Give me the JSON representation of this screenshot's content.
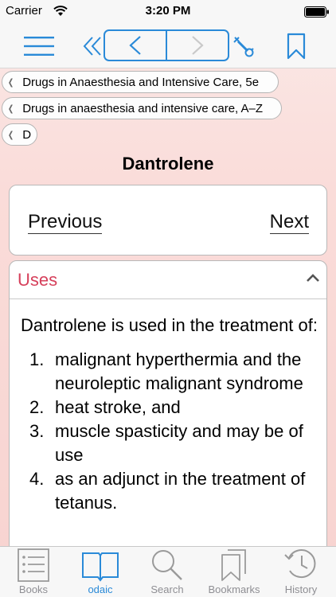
{
  "status_bar": {
    "carrier": "Carrier",
    "time": "3:20 PM"
  },
  "toolbar": {
    "menu_icon": "hamburger-menu-icon",
    "rewind_icon": "double-chevron-left-icon",
    "back_icon": "chevron-left-icon",
    "forward_icon": "chevron-right-icon",
    "wrench_icon": "wrench-icon",
    "bookmark_icon": "bookmark-icon"
  },
  "breadcrumbs": [
    {
      "label": "Drugs in Anaesthesia and Intensive Care, 5e"
    },
    {
      "label": "Drugs in anaesthesia and intensive care, A–Z"
    },
    {
      "label": "D"
    }
  ],
  "page_title": "Dantrolene",
  "pager": {
    "previous": "Previous",
    "next": "Next"
  },
  "uses": {
    "title": "Uses",
    "intro": "Dantrolene is used in the treatment of:",
    "items": [
      {
        "num": "1.",
        "text": "malignant hyperthermia and the neuroleptic malignant syndrome"
      },
      {
        "num": "2.",
        "text": "heat stroke, and"
      },
      {
        "num": "3.",
        "text": "muscle spasticity and may be of use"
      },
      {
        "num": "4.",
        "text": "as an adjunct in the treatment of tetanus."
      }
    ]
  },
  "tabs": [
    {
      "label": "Books",
      "icon": "books-icon"
    },
    {
      "label": "odaic",
      "icon": "open-book-icon"
    },
    {
      "label": "Search",
      "icon": "search-icon"
    },
    {
      "label": "Bookmarks",
      "icon": "bookmarks-icon"
    },
    {
      "label": "History",
      "icon": "history-icon"
    }
  ],
  "colors": {
    "accent": "#2a8ad8",
    "section_title": "#d6405b",
    "background": "#fadcd9"
  }
}
